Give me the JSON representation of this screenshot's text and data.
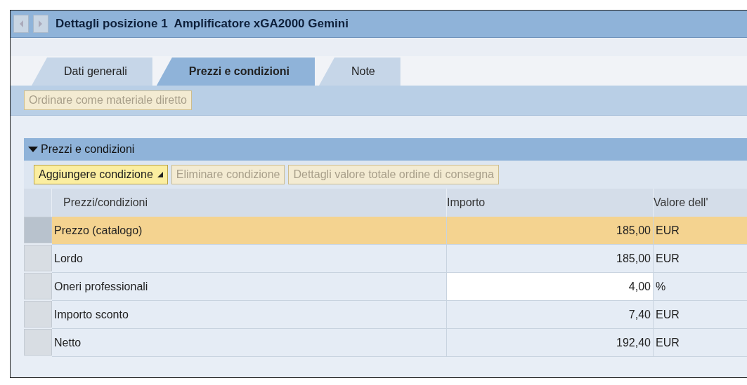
{
  "window": {
    "title": "Dettagli posizione 1  Amplificatore xGA2000 Gemini"
  },
  "tabs": [
    {
      "label": "Dati generali",
      "selected": false
    },
    {
      "label": "Prezzi e condizioni",
      "selected": true
    },
    {
      "label": "Note",
      "selected": false
    }
  ],
  "tab_toolbar": [
    {
      "label": "Ordinare come materiale diretto",
      "disabled": true
    }
  ],
  "section": {
    "title": "Prezzi e condizioni",
    "expanded": true,
    "toolbar": [
      {
        "label": "Aggiungere condizione",
        "disabled": false,
        "menu": true
      },
      {
        "label": "Eliminare condizione",
        "disabled": true,
        "menu": false
      },
      {
        "label": "Dettagli valore totale ordine di consegna",
        "disabled": true,
        "menu": false
      }
    ],
    "table": {
      "columns": [
        "Prezzi/condizioni",
        "Importo",
        "Valore dell'"
      ],
      "rows": [
        {
          "name": "Prezzo (catalogo)",
          "amount": "185,00",
          "unit": "EUR",
          "selected": true,
          "editable": false
        },
        {
          "name": "Lordo",
          "amount": "185,00",
          "unit": "EUR",
          "selected": false,
          "editable": false
        },
        {
          "name": "Oneri professionali",
          "amount": "4,00",
          "unit": "%",
          "selected": false,
          "editable": true
        },
        {
          "name": "Importo sconto",
          "amount": "7,40",
          "unit": "EUR",
          "selected": false,
          "editable": false
        },
        {
          "name": "Netto",
          "amount": "192,40",
          "unit": "EUR",
          "selected": false,
          "editable": false
        }
      ]
    }
  }
}
